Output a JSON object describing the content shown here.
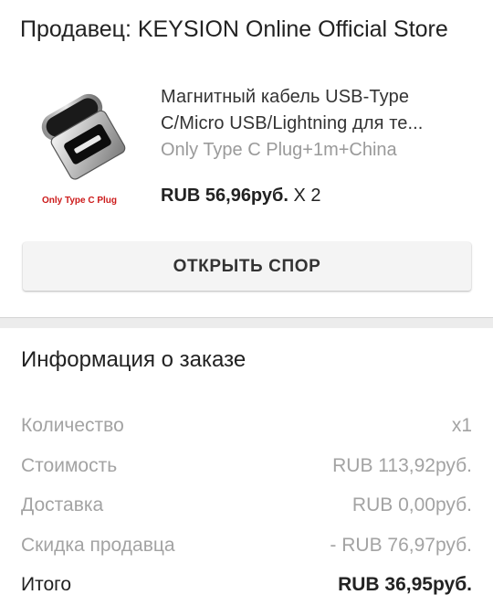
{
  "seller": {
    "label": "Продавец: KEYSION Online Official Store"
  },
  "product": {
    "image_label": "Only Type C Plug",
    "title_line1": "Магнитный кабель USB-Type",
    "title_line2": "C/Micro USB/Lightning для те...",
    "variant": "Only Type C Plug+1m+China",
    "price": "RUB 56,96руб.",
    "quantity": "X 2"
  },
  "actions": {
    "dispute_label": "ОТКРЫТЬ СПОР"
  },
  "order_info": {
    "title": "Информация о заказе",
    "rows": [
      {
        "label": "Количество",
        "value": "x1"
      },
      {
        "label": "Стоимость",
        "value": "RUB 113,92руб."
      },
      {
        "label": "Доставка",
        "value": "RUB 0,00руб."
      },
      {
        "label": "Скидка продавца",
        "value": "- RUB 76,97руб."
      }
    ],
    "total": {
      "label": "Итого",
      "value": "RUB 36,95руб."
    }
  },
  "colors": {
    "label_grey": "#a3a3a3",
    "image_text_red": "#cc1a1a",
    "divider": "#ececec"
  }
}
